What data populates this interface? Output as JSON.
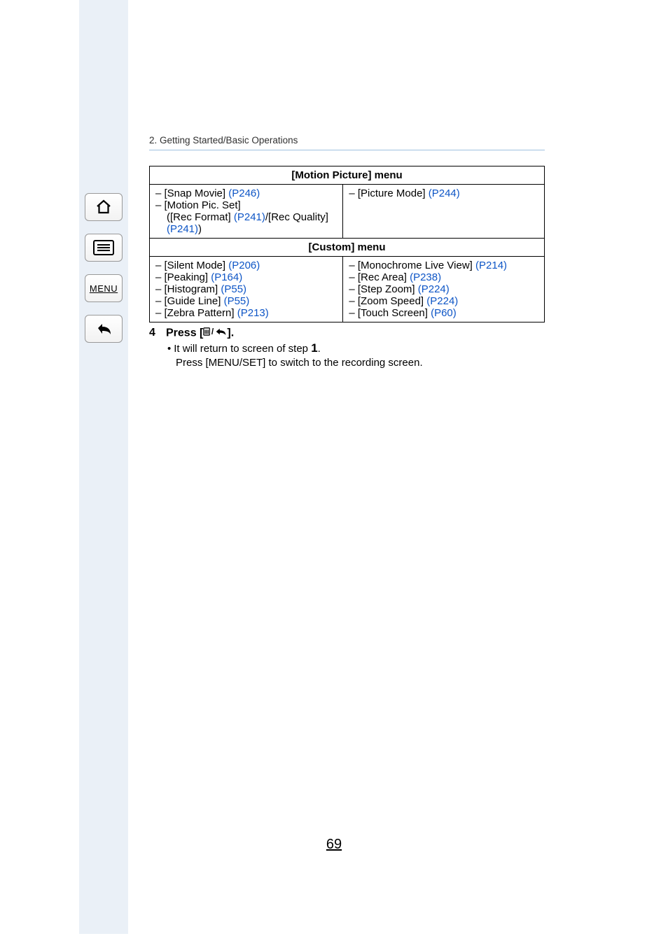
{
  "breadcrumb": "2. Getting Started/Basic Operations",
  "sections": {
    "motion_picture": {
      "header": "[Motion Picture] menu",
      "left": {
        "i0": {
          "prefix": "– [Snap Movie] ",
          "page": "(P246)"
        },
        "i1": {
          "prefix": "– [Motion Pic. Set]"
        },
        "i2a": {
          "prefix": "([Rec Format] ",
          "page": "(P241)",
          "mid": "/[Rec Quality]"
        },
        "i2b": {
          "page": "(P241)",
          "suffix": ")"
        }
      },
      "right": {
        "i0": {
          "prefix": "– [Picture Mode] ",
          "page": "(P244)"
        }
      }
    },
    "custom": {
      "header": "[Custom] menu",
      "left": {
        "i0": {
          "prefix": "– [Silent Mode] ",
          "page": "(P206)"
        },
        "i1": {
          "prefix": "– [Peaking] ",
          "page": "(P164)"
        },
        "i2": {
          "prefix": "– [Histogram] ",
          "page": "(P55)"
        },
        "i3": {
          "prefix": "– [Guide Line] ",
          "page": "(P55)"
        },
        "i4": {
          "prefix": "– [Zebra Pattern] ",
          "page": "(P213)"
        }
      },
      "right": {
        "i0": {
          "prefix": "– [Monochrome Live View] ",
          "page": "(P214)"
        },
        "i1": {
          "prefix": "– [Rec Area] ",
          "page": "(P238)"
        },
        "i2": {
          "prefix": "– [Step Zoom] ",
          "page": "(P224)"
        },
        "i3": {
          "prefix": "– [Zoom Speed] ",
          "page": "(P224)"
        },
        "i4": {
          "prefix": "– [Touch Screen] ",
          "page": "(P60)"
        }
      }
    }
  },
  "step": {
    "num": "4",
    "title_before": "Press [",
    "title_after": "].",
    "bullet": "It will return to screen of step ",
    "bullet_step": "1",
    "bullet_tail": ".",
    "line2": "Press [MENU/SET] to switch to the recording screen."
  },
  "page_number": "69",
  "sidebar": {
    "menu_label": "MENU"
  }
}
